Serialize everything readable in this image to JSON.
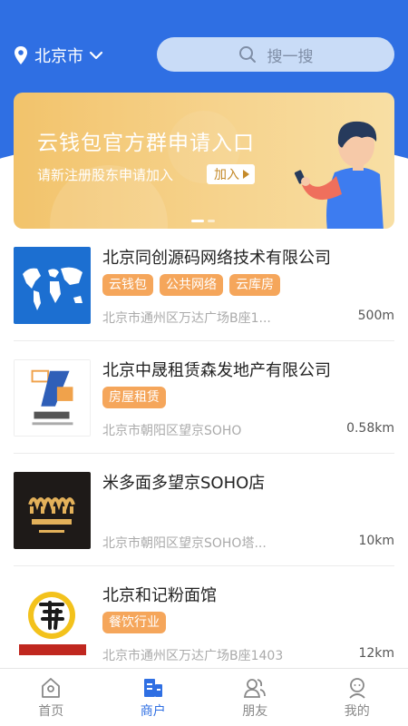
{
  "header": {
    "city": "北京市",
    "search_placeholder": "搜一搜"
  },
  "banner": {
    "title": "云钱包官方群申请入口",
    "subtitle": "请新注册股东申请加入",
    "join_label": "加入"
  },
  "merchants": [
    {
      "name": "北京同创源码网络技术有限公司",
      "tags": [
        "云钱包",
        "公共网络",
        "云库房"
      ],
      "address": "北京市通州区万达广场B座1...",
      "distance": "500m",
      "thumb": "world-map"
    },
    {
      "name": "北京中晟租赁森发地产有限公司",
      "tags": [
        "房屋租赁"
      ],
      "address": "北京市朝阳区望京SOHO",
      "distance": "0.58km",
      "thumb": "zhongsheng-logo"
    },
    {
      "name": "米多面多望京SOHO店",
      "tags": [],
      "address": "北京市朝阳区望京SOHO塔...",
      "distance": "10km",
      "thumb": "midou-logo"
    },
    {
      "name": "北京和记粉面馆",
      "tags": [
        "餐饮行业"
      ],
      "address": "北京市通州区万达广场B座1403",
      "distance": "12km",
      "thumb": "noodle-logo"
    }
  ],
  "tabs": [
    {
      "label": "首页",
      "icon": "home-icon",
      "active": false
    },
    {
      "label": "商户",
      "icon": "shop-icon",
      "active": true
    },
    {
      "label": "朋友",
      "icon": "friends-icon",
      "active": false
    },
    {
      "label": "我的",
      "icon": "profile-icon",
      "active": false
    }
  ],
  "colors": {
    "primary": "#2f6fe3",
    "tag": "#f5a65b",
    "banner": "#f4c978"
  }
}
